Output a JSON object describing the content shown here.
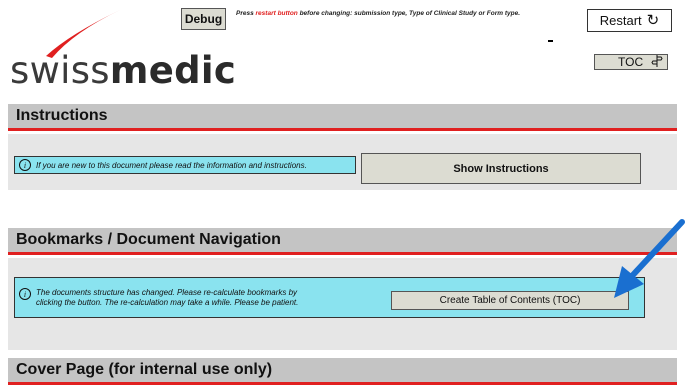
{
  "header": {
    "logo": {
      "prefix": "swiss",
      "suffix": "medic",
      "accent_color": "#e02020"
    },
    "debug_label": "Debug",
    "notice": {
      "before": "Press ",
      "highlight": "restart button",
      "after": " before changing: submission type, Type of Clinical Study or Form type."
    },
    "restart_label": "Restart",
    "restart_icon": "refresh-icon",
    "dash_text": "-",
    "toc_label": "TOC",
    "toc_icon": "signpost-icon"
  },
  "sections": {
    "instructions": {
      "title": "Instructions",
      "info_icon": "i",
      "info_text": "If you are new to this document please read the information and instructions.",
      "button_label": "Show Instructions"
    },
    "bookmarks": {
      "title": "Bookmarks / Document Navigation",
      "info_icon": "i",
      "info_text": "The documents structure has changed. Please re-calculate bookmarks by clicking the button. The re-calculation may take a while. Please be patient.",
      "button_label": "Create Table of Contents (TOC)"
    },
    "cover": {
      "title": "Cover Page (for internal use only)"
    }
  },
  "colors": {
    "section_bar": "#c4c4c4",
    "section_underline": "#e02020",
    "info_box": "#8ae3ef",
    "button": "#dcdcd2",
    "arrow": "#1a6fd0"
  }
}
